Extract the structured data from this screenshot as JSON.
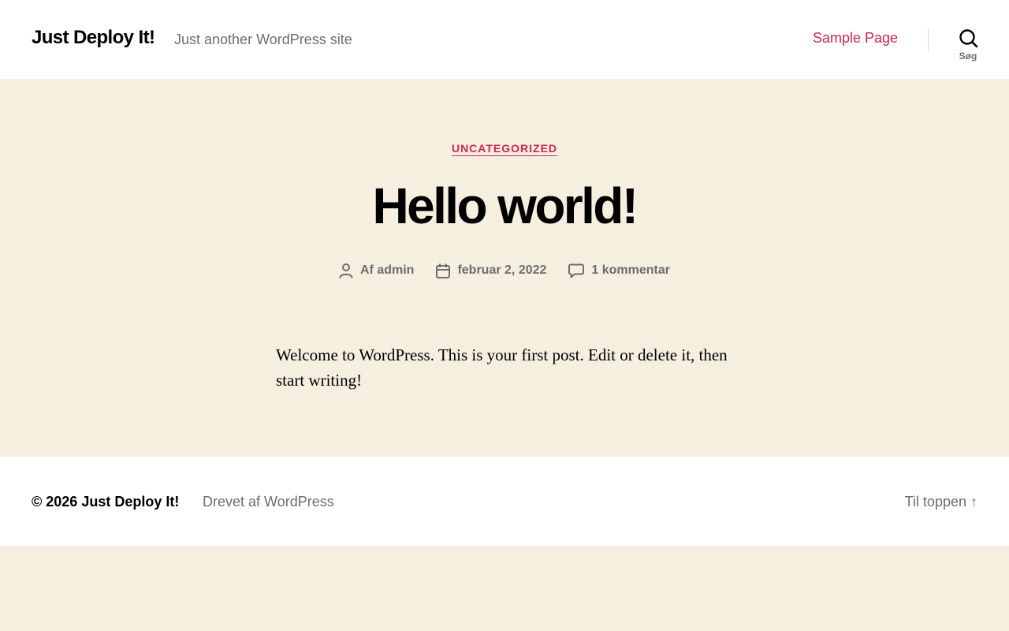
{
  "header": {
    "site_title": "Just Deploy It!",
    "site_description": "Just another WordPress site",
    "nav": [
      {
        "label": "Sample Page"
      }
    ],
    "search_label": "Søg"
  },
  "post": {
    "category": "Uncategorized",
    "title": "Hello world!",
    "meta": {
      "author": "Af admin",
      "date": "februar 2, 2022",
      "comments": "1 kommentar"
    },
    "content": "Welcome to WordPress. This is your first post. Edit or delete it, then start writing!"
  },
  "footer": {
    "copyright_prefix": "© 2026",
    "copyright_site": "Just Deploy It!",
    "powered_by": "Drevet af WordPress",
    "back_to_top": "Til toppen ↑"
  },
  "colors": {
    "accent": "#cd2653",
    "background": "#f5efe0",
    "secondary_text": "#6d6d6d"
  },
  "icons": [
    "search-icon",
    "user-icon",
    "calendar-icon",
    "comment-icon"
  ]
}
